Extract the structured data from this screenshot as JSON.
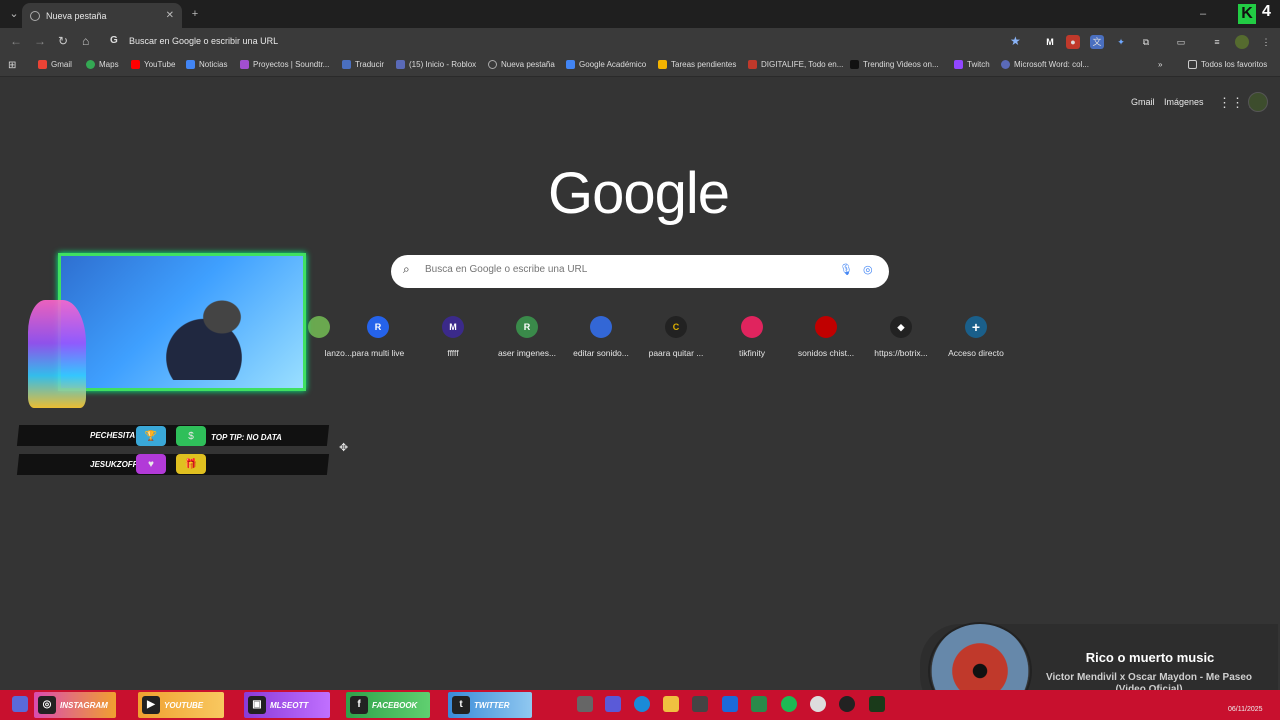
{
  "browser": {
    "tab_title": "Nueva pestaña",
    "omnibox_placeholder": "Buscar en Google o escribir una URL",
    "bookmarks": [
      "Gmail",
      "Maps",
      "YouTube",
      "Noticias",
      "Proyectos | Soundtr...",
      "Traducir",
      "(15) Inicio - Roblox",
      "Nueva pestaña",
      "Google Académico",
      "Tareas pendientes",
      "DIGITALIFE, Todo en...",
      "Trending Videos on...",
      "Twitch",
      "Microsoft Word: col..."
    ],
    "all_bookmarks": "Todos los favoritos"
  },
  "page": {
    "top_links": [
      "Gmail",
      "Imágenes"
    ],
    "logo": "Google",
    "search_placeholder": "Busca en Google o escribe una URL",
    "shortcuts": [
      {
        "letter": "",
        "label": "lanzo...",
        "color": "#6aa84f"
      },
      {
        "letter": "R",
        "label": "para multi live",
        "color": "#2563eb"
      },
      {
        "letter": "M",
        "label": "fffff",
        "color": "#3b2a8a"
      },
      {
        "letter": "R",
        "label": "aser imgenes...",
        "color": "#3a8a4a"
      },
      {
        "letter": "",
        "label": "editar sonido...",
        "color": "#3367d6"
      },
      {
        "letter": "C",
        "label": "paara quitar ...",
        "color": "#222222"
      },
      {
        "letter": "",
        "label": "tikfinity",
        "color": "#e0245e"
      },
      {
        "letter": "",
        "label": "sonidos chist...",
        "color": "#c00000"
      },
      {
        "letter": "",
        "label": "https://botrix...",
        "color": "#222222"
      },
      {
        "letter": "+",
        "label": "Acceso directo",
        "color": "#1a5f8a"
      }
    ]
  },
  "overlay": {
    "stat1_name": "PECHESITA",
    "stat1_tip": "TOP TIP: NO DATA",
    "stat2_name": "JESUKZOFF",
    "socials": [
      "INSTAGRAM",
      "YOUTUBE",
      "MLSEOTT",
      "FACEBOOK",
      "TWITTER"
    ]
  },
  "music": {
    "title": "Rico o muerto music",
    "artist": "Victor Mendivil x Oscar Maydon - Me Paseo (Video Oficial)"
  },
  "taskbar": {
    "date": "06/11/2025"
  },
  "colors": {
    "accent": "#c8102e",
    "page_bg": "#343434"
  }
}
